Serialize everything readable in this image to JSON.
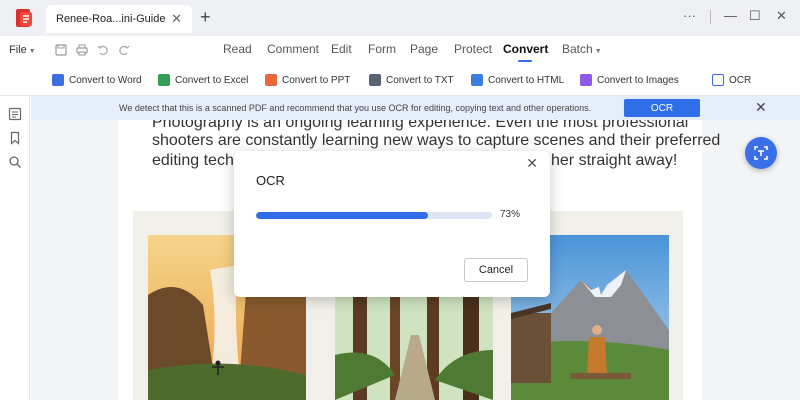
{
  "titlebar": {
    "tab_label": "Renee-Roa...ini-Guide",
    "tab_close": "✕",
    "new_tab": "+",
    "more": "···",
    "minimize": "—",
    "maximize": "☐",
    "close": "✕"
  },
  "menubar": {
    "file": "File",
    "items": [
      "Read",
      "Comment",
      "Edit",
      "Form",
      "Page",
      "Protect",
      "Convert",
      "Batch"
    ],
    "active": "Convert"
  },
  "convert_toolbar": [
    {
      "label": "Convert to Word",
      "color": "#3b6ee0"
    },
    {
      "label": "Convert to Excel",
      "color": "#2e9e4f"
    },
    {
      "label": "Convert to PPT",
      "color": "#e8663a"
    },
    {
      "label": "Convert to TXT",
      "color": "#5a6472"
    },
    {
      "label": "Convert to HTML",
      "color": "#3b7be0"
    },
    {
      "label": "Convert to Images",
      "color": "#8e5ae6"
    },
    {
      "label": "OCR",
      "color": "#3b6ee0"
    }
  ],
  "banner": {
    "message": "We detect that this is a scanned PDF and recommend that you use OCR for editing, copying text and other operations.",
    "button": "OCR",
    "close": "✕"
  },
  "document": {
    "lines": [
      "Photography is an ongoing learning experience. Even the most professional",
      "shooters are constantly learning new ways to capture scenes and their preferred",
      "editing techn",
      "her straight away!"
    ]
  },
  "ocr_dialog": {
    "title": "OCR",
    "close": "✕",
    "progress": 73,
    "progress_label": "73%",
    "cancel": "Cancel"
  },
  "colors": {
    "accent": "#2f6ee8",
    "banner_bg": "#e6eefc",
    "app_red": "#d9302c"
  }
}
